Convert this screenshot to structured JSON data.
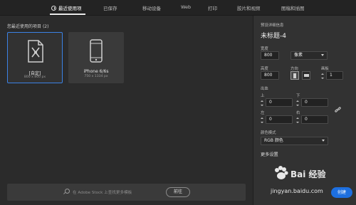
{
  "tabs": [
    {
      "label": "最近使用项"
    },
    {
      "label": "已保存"
    },
    {
      "label": "移动设备"
    },
    {
      "label": "Web"
    },
    {
      "label": "打印"
    },
    {
      "label": "胶片和视频"
    },
    {
      "label": "图稿和插图"
    }
  ],
  "recent": {
    "title": "您最近使用的项目",
    "count": "(2)",
    "items": [
      {
        "name": "[自定]",
        "size": "800 x 800 px"
      },
      {
        "name": "iPhone 6/6s",
        "size": "750 x 1334 px"
      }
    ]
  },
  "search": {
    "placeholder": "在 Adobe Stock 上查找更多模板",
    "go_label": "前往"
  },
  "preset": {
    "section_label": "预设详细信息",
    "title": "未标题-4",
    "width_label": "宽度",
    "width_value": "800",
    "unit_value": "像素",
    "height_label": "高度",
    "height_value": "800",
    "orientation_label": "方向",
    "artboards_label": "画板",
    "artboards_value": "1",
    "bleed_label": "出血",
    "top_label": "上",
    "top_value": "0",
    "bottom_label": "下",
    "bottom_value": "0",
    "left_label": "左",
    "left_value": "0",
    "right_label": "右",
    "right_value": "0",
    "color_mode_label": "颜色模式",
    "color_mode_value": "RGB 颜色",
    "more_settings": "更多设置",
    "create_label": "创建"
  },
  "watermark": {
    "brand": "Bai 经验",
    "url": "jingyan.baidu.com"
  }
}
